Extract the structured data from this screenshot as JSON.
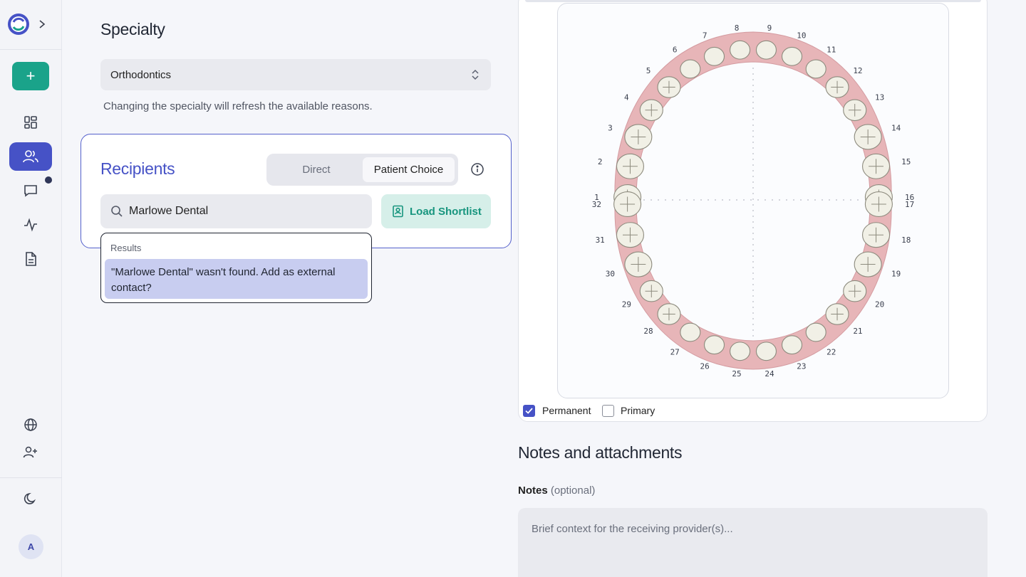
{
  "sidebar": {
    "new_label": "+",
    "avatar_initial": "A"
  },
  "specialty": {
    "title": "Specialty",
    "selected": "Orthodontics",
    "hint": "Changing the specialty will refresh the available reasons."
  },
  "recipients": {
    "title": "Recipients",
    "tabs": [
      {
        "label": "Direct",
        "active": false
      },
      {
        "label": "Patient Choice",
        "active": true
      }
    ],
    "search_value": "Marlowe Dental",
    "load_shortlist_label": "Load Shortlist",
    "results_label": "Results",
    "not_found_option": "\"Marlowe Dental\" wasn't found. Add as external contact?"
  },
  "tooth_chart": {
    "upper_numbers": [
      "1",
      "2",
      "3",
      "4",
      "5",
      "6",
      "7",
      "8",
      "9",
      "10",
      "11",
      "12",
      "13",
      "14",
      "15",
      "16"
    ],
    "lower_numbers": [
      "17",
      "18",
      "19",
      "20",
      "21",
      "22",
      "23",
      "24",
      "25",
      "26",
      "27",
      "28",
      "29",
      "30",
      "31",
      "32"
    ],
    "permanent_label": "Permanent",
    "permanent_checked": true,
    "primary_label": "Primary",
    "primary_checked": false
  },
  "notes": {
    "section_title": "Notes and attachments",
    "label": "Notes",
    "optional": "(optional)",
    "placeholder": "Brief context for the receiving provider(s)..."
  },
  "colors": {
    "accent": "#4652c6",
    "brand_green": "#1aa38a",
    "gum": "#e7b5b8"
  }
}
